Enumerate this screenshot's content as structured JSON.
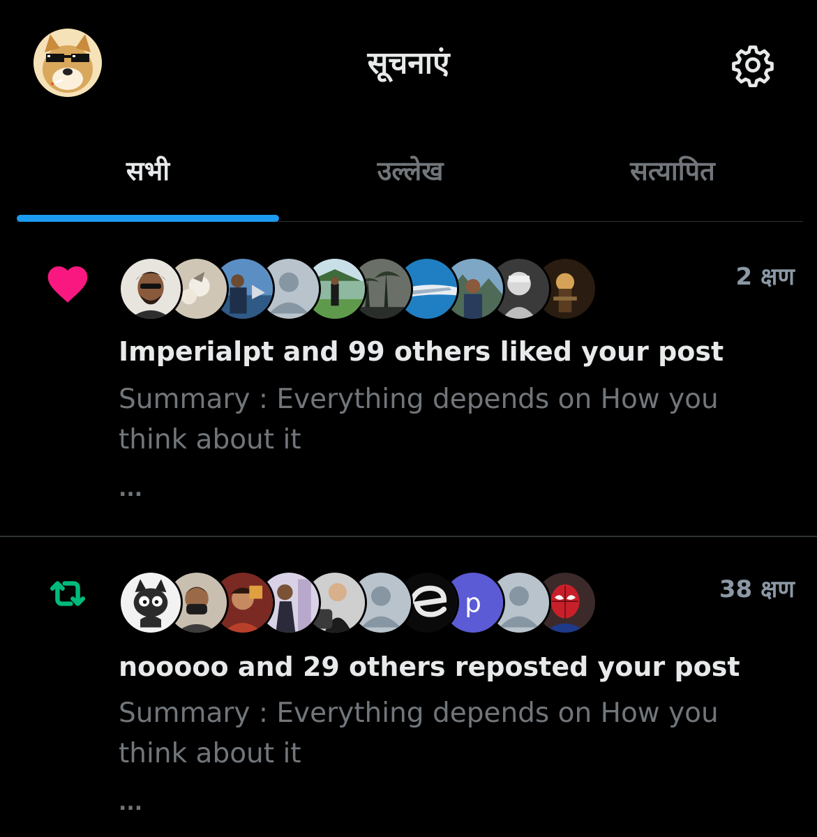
{
  "header": {
    "title": "सूचनाएं",
    "avatar_icon": "doge-sunglasses-avatar",
    "settings_icon": "gear-icon"
  },
  "tabs": [
    {
      "label": "सभी",
      "active": true
    },
    {
      "label": "उल्लेख",
      "active": false
    },
    {
      "label": "सत्यापित",
      "active": false
    }
  ],
  "colors": {
    "accent": "#1d9bf0",
    "like": "#f91880",
    "repost": "#00ba7c",
    "muted_text": "#71767b",
    "primary_text": "#e7e9ea",
    "divider": "#2f3336"
  },
  "notifications": [
    {
      "type": "like",
      "icon": "heart-icon",
      "time": "2 क्षण",
      "headline": "Imperialpt and 99 others liked your post",
      "summary": "Summary : Everything depends on How you think about it",
      "more": "..."
    },
    {
      "type": "repost",
      "icon": "repost-icon",
      "time": "38 क्षण",
      "headline": "nooooo and 29 others reposted your post",
      "summary": "Summary : Everything depends on How you think about it",
      "more": "...",
      "avatar_letter": "p"
    }
  ]
}
